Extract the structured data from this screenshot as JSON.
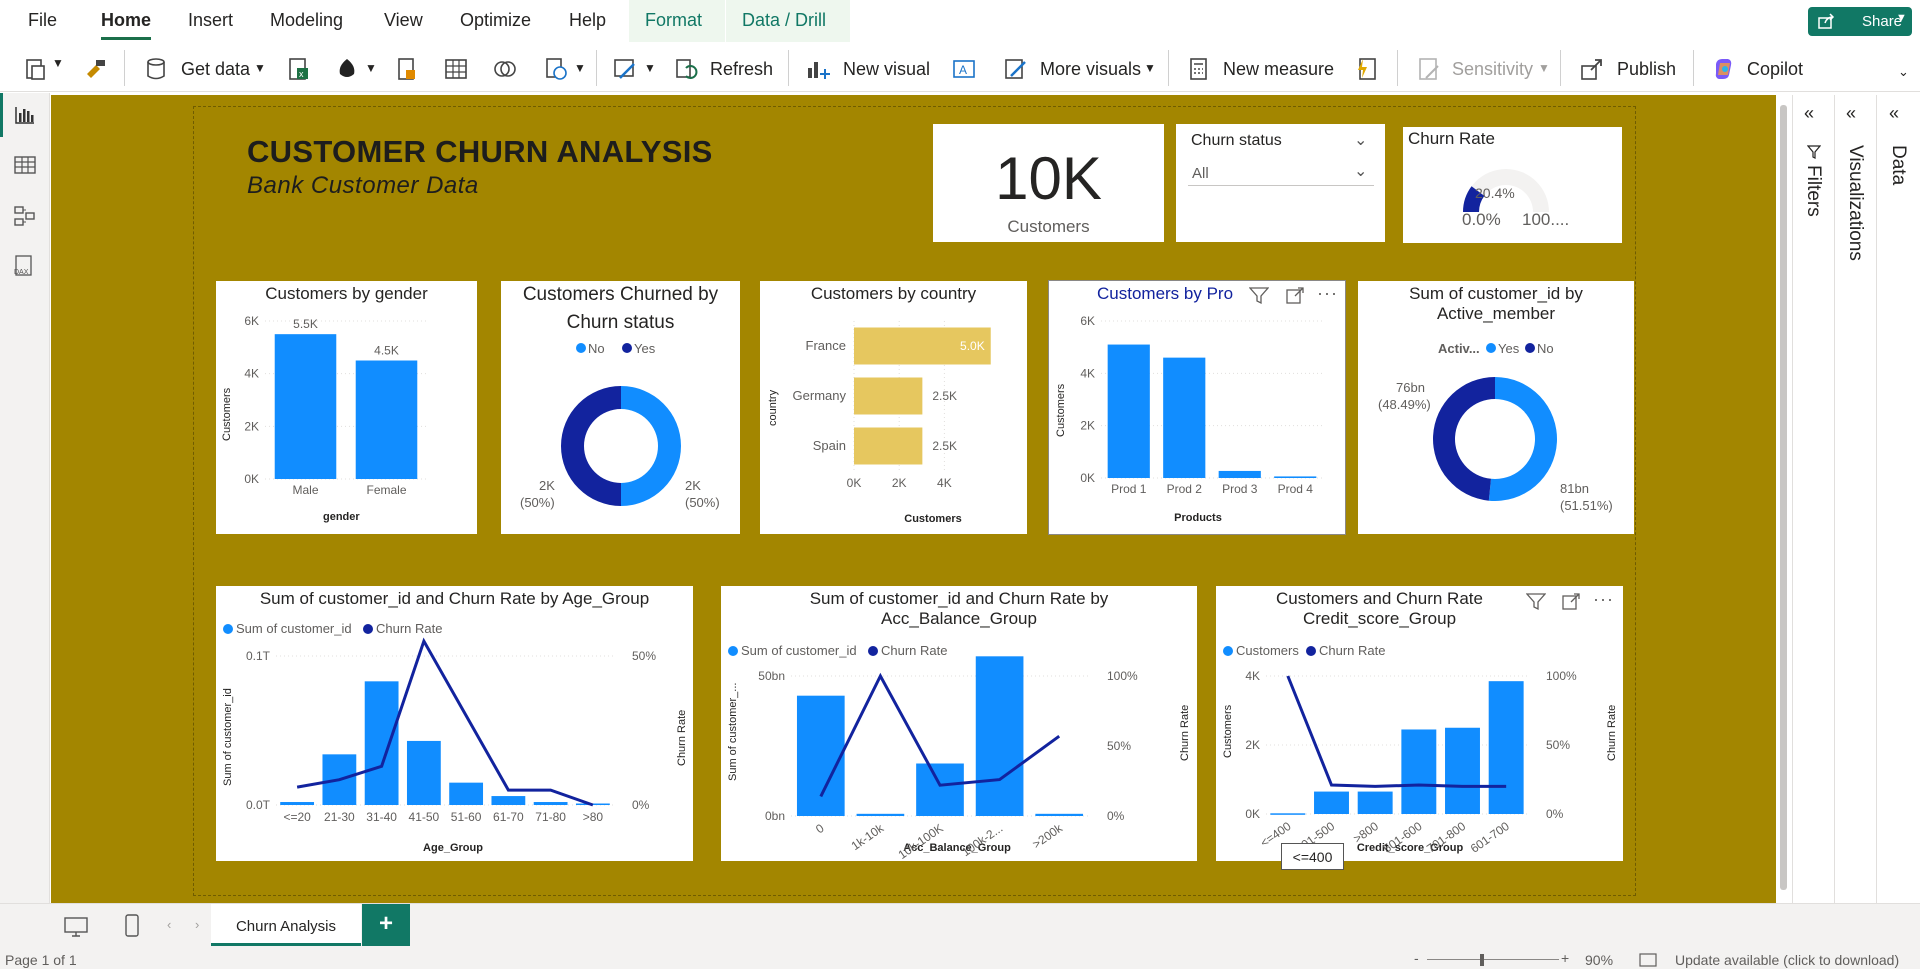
{
  "menu": {
    "file": "File",
    "home": "Home",
    "insert": "Insert",
    "modeling": "Modeling",
    "view": "View",
    "optimize": "Optimize",
    "help": "Help",
    "format": "Format",
    "datadrill": "Data / Drill",
    "share": "Share"
  },
  "ribbon": {
    "get_data": "Get data",
    "refresh": "Refresh",
    "new_visual": "New visual",
    "more_visuals": "More visuals",
    "new_measure": "New measure",
    "sensitivity": "Sensitivity",
    "publish": "Publish",
    "copilot": "Copilot"
  },
  "right_panes": {
    "filters": "Filters",
    "visualizations": "Visualizations",
    "data": "Data"
  },
  "header": {
    "title": "CUSTOMER CHURN ANALYSIS",
    "subtitle": "Bank Customer Data"
  },
  "kpi": {
    "value": "10K",
    "label": "Customers"
  },
  "slicer": {
    "title": "Churn status",
    "value": "All"
  },
  "gauge": {
    "title": "Churn Rate",
    "value_label": "20.4%",
    "min_label": "0.0%",
    "max_label": "100....",
    "value": 0.204
  },
  "colors": {
    "canvas": "#a38600",
    "blue": "#118dff",
    "navy": "#12239e",
    "gold": "#e6c75f"
  },
  "charts": {
    "gender": {
      "title": "Customers by gender",
      "xlabel": "gender",
      "ylabel": "Customers"
    },
    "churned": {
      "title_line1": "Customers Churned by",
      "title_line2": "Churn status",
      "legend_no": "No",
      "legend_yes": "Yes",
      "label_left": "2K",
      "pct_left": "(50%)",
      "label_right": "2K",
      "pct_right": "(50%)"
    },
    "country": {
      "title": "Customers by country",
      "xlabel": "Customers",
      "ylabel": "country"
    },
    "products": {
      "title": "Customers by Pro",
      "xlabel": "Products",
      "ylabel": "Customers"
    },
    "active": {
      "title_line1": "Sum of customer_id by",
      "title_line2": "Active_member",
      "legend_title": "Activ...",
      "legend_yes": "Yes",
      "legend_no": "No",
      "label_left": "76bn",
      "pct_left": "(48.49%)",
      "label_right": "81bn",
      "pct_right": "(51.51%)"
    },
    "age": {
      "title": "Sum of customer_id and Churn Rate by Age_Group",
      "legend1": "Sum of customer_id",
      "legend2": "Churn Rate",
      "xlabel": "Age_Group",
      "ylabel": "Sum of customer_id",
      "y2label": "Churn Rate"
    },
    "balance": {
      "title_line1": "Sum of customer_id and Churn Rate by",
      "title_line2": "Acc_Balance_Group",
      "legend1": "Sum of customer_id",
      "legend2": "Churn Rate",
      "xlabel": "Acc_Balance_Group",
      "ylabel": "Sum of customer_...",
      "y2label": "Churn Rate"
    },
    "credit": {
      "title_line1": "Customers and Churn Rate",
      "title_line2": "Credit_score_Group",
      "legend1": "Customers",
      "legend2": "Churn Rate",
      "xlabel": "Credit_score_Group",
      "ylabel": "Customers",
      "y2label": "Churn Rate",
      "tooltip": "<=400"
    }
  },
  "chart_data": [
    {
      "type": "bar",
      "title": "Customers by gender",
      "categories": [
        "Male",
        "Female"
      ],
      "values": [
        5500,
        4500
      ],
      "data_labels": [
        "5.5K",
        "4.5K"
      ],
      "yticks": [
        "0K",
        "2K",
        "4K",
        "6K"
      ],
      "ylim": [
        0,
        6000
      ]
    },
    {
      "type": "pie",
      "title": "Customers Churned by Churn status",
      "categories": [
        "No",
        "Yes"
      ],
      "values": [
        50,
        50
      ]
    },
    {
      "type": "bar",
      "title": "Customers by country",
      "orientation": "horizontal",
      "categories": [
        "France",
        "Germany",
        "Spain"
      ],
      "values": [
        5000,
        2500,
        2500
      ],
      "data_labels": [
        "5.0K",
        "2.5K",
        "2.5K"
      ],
      "xticks": [
        "0K",
        "2K",
        "4K"
      ],
      "xlim": [
        0,
        5000
      ]
    },
    {
      "type": "bar",
      "title": "Customers by Products",
      "categories": [
        "Prod 1",
        "Prod 2",
        "Prod 3",
        "Prod 4"
      ],
      "values": [
        5100,
        4600,
        270,
        60
      ],
      "yticks": [
        "0K",
        "2K",
        "4K",
        "6K"
      ],
      "ylim": [
        0,
        6000
      ]
    },
    {
      "type": "pie",
      "title": "Sum of customer_id by Active_member",
      "categories": [
        "Yes",
        "No"
      ],
      "values": [
        81,
        76
      ]
    },
    {
      "type": "bar",
      "title": "Sum of customer_id and Churn Rate by Age_Group",
      "categories": [
        "<=20",
        "21-30",
        "31-40",
        "41-50",
        "51-60",
        "61-70",
        "71-80",
        ">80"
      ],
      "series": [
        {
          "name": "Sum of customer_id",
          "values": [
            0.002,
            0.034,
            0.083,
            0.043,
            0.015,
            0.006,
            0.002,
            0.001
          ]
        },
        {
          "name": "Churn Rate",
          "values": [
            0.06,
            0.085,
            0.13,
            0.55,
            0.3,
            0.05,
            0.05,
            0
          ]
        }
      ],
      "yticks_left": [
        "0.0T",
        "0.1T"
      ],
      "yticks_right": [
        "0%",
        "50%"
      ]
    },
    {
      "type": "bar",
      "title": "Sum of customer_id and Churn Rate by Acc_Balance_Group",
      "categories": [
        "0",
        "1k-10k",
        "10k-100K",
        "100k-2...",
        ">200k"
      ],
      "series": [
        {
          "name": "Sum of customer_id",
          "values": [
            55,
            1,
            24,
            73,
            1
          ]
        },
        {
          "name": "Churn Rate",
          "values": [
            0.14,
            1.0,
            0.22,
            0.26,
            0.57
          ]
        }
      ],
      "yticks_left": [
        "0bn",
        "50bn"
      ],
      "yticks_right": [
        "0%",
        "50%",
        "100%"
      ]
    },
    {
      "type": "bar",
      "title": "Customers and Churn Rate Credit_score_Group",
      "categories": [
        "<=400",
        "401-500",
        ">800",
        "501-600",
        "701-800",
        "601-700"
      ],
      "series": [
        {
          "name": "Customers",
          "values": [
            20,
            650,
            650,
            2450,
            2500,
            3850
          ]
        },
        {
          "name": "Churn Rate",
          "values": [
            1.0,
            0.21,
            0.2,
            0.21,
            0.2,
            0.2
          ]
        }
      ],
      "yticks_left": [
        "0K",
        "2K",
        "4K"
      ],
      "yticks_right": [
        "0%",
        "50%",
        "100%"
      ]
    }
  ],
  "pages": {
    "tab": "Churn Analysis",
    "add": "+"
  },
  "status": {
    "page": "Page 1 of 1",
    "zoom": "90%",
    "update": "Update available (click to download)"
  }
}
